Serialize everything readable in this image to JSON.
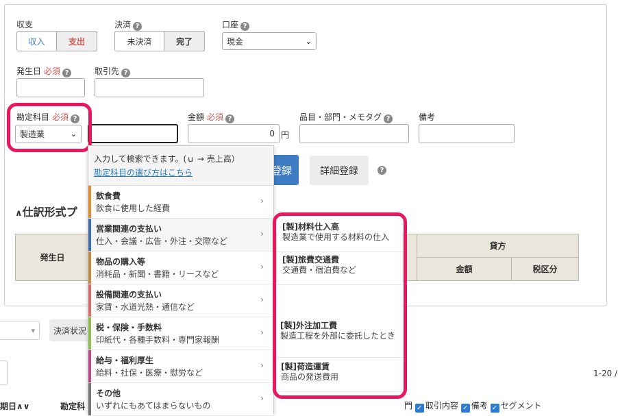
{
  "form": {
    "income_expense": {
      "label": "収支",
      "options": [
        "収入",
        "支出"
      ],
      "selected": "支出"
    },
    "settlement": {
      "label": "決済",
      "options": [
        "未決済",
        "完了"
      ],
      "selected": "完了"
    },
    "account": {
      "label": "口座",
      "value": "現金"
    },
    "date": {
      "label": "発生日",
      "required": "必須",
      "value": ""
    },
    "partner": {
      "label": "取引先",
      "value": ""
    },
    "account_item": {
      "label": "勘定科目",
      "required": "必須",
      "value": "製造業",
      "search_value": ""
    },
    "amount": {
      "label": "金額",
      "required": "必須",
      "value": "0",
      "unit": "円"
    },
    "item_tag": {
      "label": "品目・部門・メモタグ",
      "value": ""
    },
    "note": {
      "label": "備考",
      "value": ""
    },
    "register_label": "登録",
    "detail_register_label": "詳細登録"
  },
  "journal": {
    "title": "仕訳形式プ",
    "headers": {
      "date": "発生日",
      "credit": "貸方",
      "amount": "金額",
      "tax": "税区分"
    }
  },
  "dropdown": {
    "hint": "入力して検索できます。(ｕ → 売上高）",
    "hint_link": "勘定科目の選び方はこちら",
    "categories": [
      {
        "name": "飲食費",
        "desc": "飲食に使用した経費",
        "color": "#e08a2b"
      },
      {
        "name": "営業関連の支払い",
        "desc": "仕入・会議・広告・外注・交際など",
        "color": "#3e6fb5"
      },
      {
        "name": "物品の購入等",
        "desc": "消耗品・新聞・書籍・リースなど",
        "color": "#c98a3e"
      },
      {
        "name": "設備関連の支払い",
        "desc": "家賃・水道光熱・通信など",
        "color": "#e06b6b"
      },
      {
        "name": "税・保険・手数料",
        "desc": "印紙代・各種手数料・専門家報酬",
        "color": "#8dc04a"
      },
      {
        "name": "給与・福利厚生",
        "desc": "給料・社保・医療・慰労など",
        "color": "#c0478a"
      },
      {
        "name": "その他",
        "desc": "いずれにもあてはまらないもの",
        "color": "#777777"
      }
    ],
    "sub_items": [
      {
        "name": "[製]材料仕入高",
        "desc": "製造業で使用する材料の仕入"
      },
      {
        "name": "[製]旅費交通費",
        "desc": "交通費・宿泊費など"
      },
      {
        "name": "[製]外注加工費",
        "desc": "製造工程を外部に委託したとき"
      },
      {
        "name": "[製]荷造運賃",
        "desc": "商品の発送費用"
      }
    ]
  },
  "bottom": {
    "settlement_status": "決済状況",
    "pagination": "1-20 /",
    "col_date": "期日",
    "col_account": "勘定科",
    "checkbox_labels": [
      "取引内容",
      "備考",
      "セグメント"
    ],
    "checkbox_partial": "門"
  },
  "colors": {
    "highlight": "#e8185f",
    "primary": "#3e7cc4",
    "required": "#d9534f"
  }
}
